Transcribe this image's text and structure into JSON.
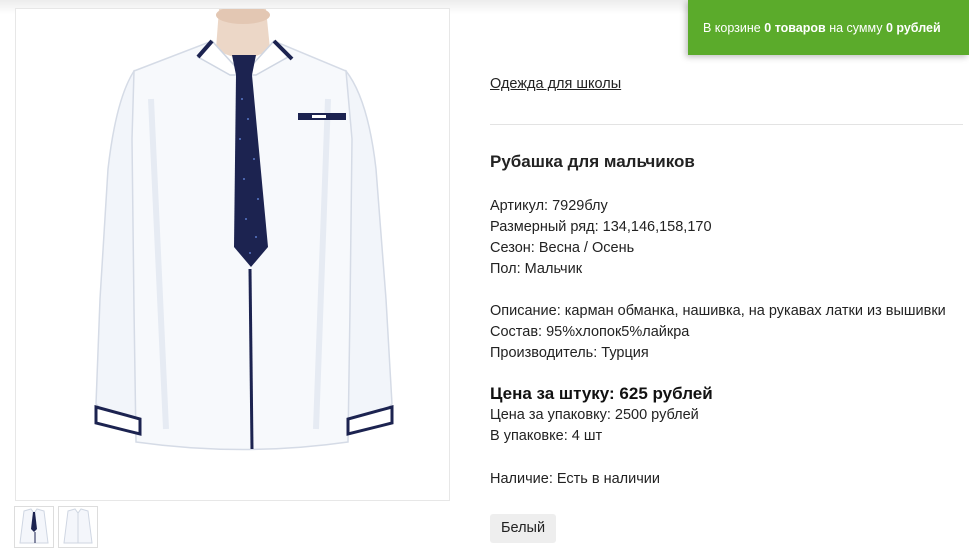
{
  "cart": {
    "prefix": "В корзине",
    "items_count": "0",
    "items_word": "товаров",
    "middle": "на сумму",
    "total": "0 рублей"
  },
  "breadcrumb": {
    "category": "Одежда для школы"
  },
  "product": {
    "title": "Рубашка для мальчиков",
    "specs": [
      "Артикул: 7929блу",
      "Размерный ряд: 134,146,158,170",
      "Сезон: Весна / Осень",
      "Пол: Мальчик"
    ],
    "details": [
      "Описание: карман обманка, нашивка, на рукавах латки из вышивки",
      "Состав: 95%хлопок5%лайкра",
      "Производитель: Турция"
    ],
    "price_per_unit": "Цена за штуку: 625 рублей",
    "pack_info": [
      "Цена за упаковку: 2500 рублей",
      "В упаковке: 4 шт"
    ],
    "availability": "Наличие: Есть в наличии",
    "color_option": "Белый"
  },
  "colors": {
    "cart_green": "#5bab2b",
    "tie_navy": "#1c2350",
    "shirt_white": "#f7f9fc"
  },
  "images": {
    "main": "white-shirt-with-navy-tie",
    "thumbnails": [
      "shirt-with-tie-thumbnail",
      "shirt-without-tie-thumbnail"
    ]
  }
}
